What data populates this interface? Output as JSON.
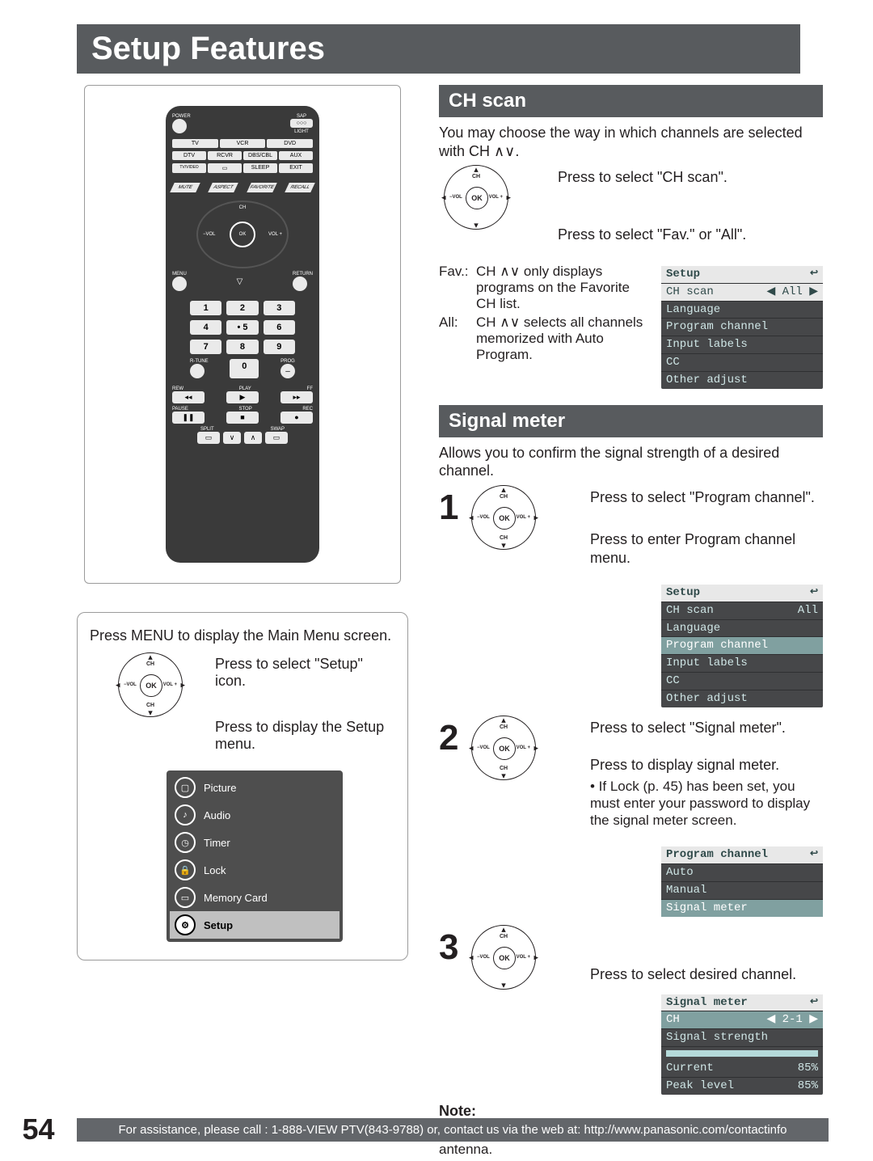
{
  "title": "Setup Features",
  "remote": {
    "labels": {
      "power": "POWER",
      "sap": "SAP",
      "light": "LIGHT",
      "tv": "TV",
      "vcr": "VCR",
      "dvd": "DVD",
      "dtv": "DTV",
      "rcvr": "RCVR",
      "dbs": "DBS/CBL",
      "aux": "AUX",
      "tvvideo": "TV/VIDEO",
      "sdcard": "▭",
      "sleep": "SLEEP",
      "exit": "EXIT",
      "mute": "MUTE",
      "aspect": "ASPECT",
      "favorite": "FAVORITE",
      "recall": "RECALL",
      "menu": "MENU",
      "return": "RETURN",
      "rtune": "R-TUNE",
      "prog": "PROG",
      "rew": "REW",
      "play": "PLAY",
      "ff": "FF",
      "pause": "PAUSE",
      "stop": "STOP",
      "rec": "REC",
      "split": "SPLIT",
      "swap": "SWAP",
      "chdn": "∨",
      "chup": "∧"
    },
    "dpad": {
      "ch": "CH",
      "vol_minus": "−VOL",
      "ok": "OK",
      "vol_plus": "VOL +"
    }
  },
  "menu_callout": {
    "intro": "Press MENU to display the Main Menu screen.",
    "line1": "Press to select \"Setup\" icon.",
    "line2": "Press to display the Setup menu.",
    "osd": {
      "items": [
        "Picture",
        "Audio",
        "Timer",
        "Lock",
        "Memory Card",
        "Setup"
      ],
      "selected": "Setup"
    }
  },
  "ch_scan": {
    "heading": "CH scan",
    "intro": "You may choose the way in which channels are selected with CH ∧∨.",
    "step1": "Press to select \"CH scan\".",
    "step2": "Press to select \"Fav.\" or \"All\".",
    "fav_lbl": "Fav.:",
    "fav_txt": "CH ∧∨ only displays programs on the Favorite CH list.",
    "all_lbl": "All:",
    "all_txt": "CH ∧∨ selects all channels memorized with Auto Program.",
    "osd": {
      "title": "Setup",
      "sel_lbl": "CH scan",
      "sel_val": "All",
      "items": [
        "Language",
        "Program channel",
        "Input labels",
        "CC",
        "Other adjust"
      ]
    }
  },
  "signal": {
    "heading": "Signal meter",
    "intro": "Allows you to confirm the signal strength of a desired channel.",
    "s1": {
      "num": "1",
      "a": "Press to select \"Program channel\".",
      "b": "Press to enter Program channel menu."
    },
    "osd1": {
      "title": "Setup",
      "row1_lbl": "CH scan",
      "row1_val": "All",
      "items": [
        "Language",
        "Program channel",
        "Input labels",
        "CC",
        "Other adjust"
      ],
      "highlight": "Program channel"
    },
    "s2": {
      "num": "2",
      "a": "Press to select \"Signal meter\".",
      "b": "Press to display signal meter.",
      "note": "• If Lock (p. 45) has been set, you must enter your password to display the signal meter screen."
    },
    "osd2": {
      "title": "Program channel",
      "items": [
        "Auto",
        "Manual",
        "Signal meter"
      ],
      "highlight": "Signal meter"
    },
    "s3": {
      "num": "3",
      "a": "Press to select desired channel."
    },
    "osd3": {
      "title": "Signal meter",
      "ch_lbl": "CH",
      "ch_val": "2-1",
      "strength": "Signal strength",
      "current_lbl": "Current",
      "current_val": "85%",
      "peak_lbl": "Peak level",
      "peak_val": "85%"
    }
  },
  "note": {
    "hd": "Note:",
    "txt": "• The signal meter works only for digital signals input via the antenna."
  },
  "footer": {
    "page": "54",
    "text": "For assistance, please call : 1-888-VIEW PTV(843-9788) or, contact us via the web at: http://www.panasonic.com/contactinfo"
  }
}
